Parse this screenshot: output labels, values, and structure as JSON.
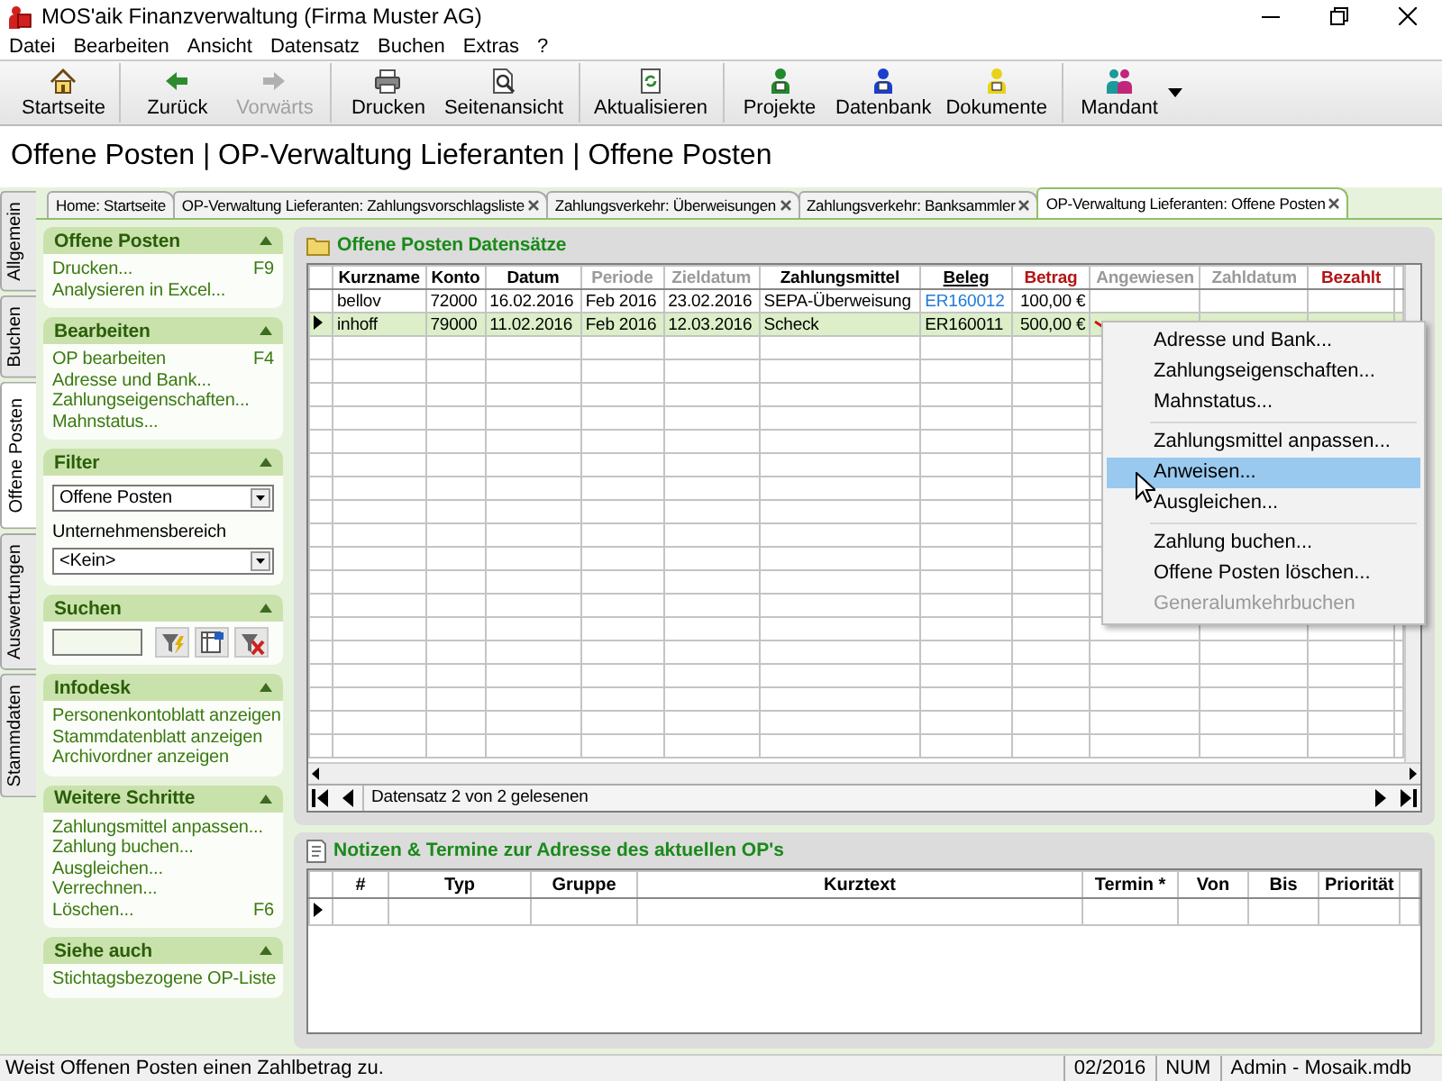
{
  "window": {
    "title": "MOS'aik Finanzverwaltung (Firma Muster AG)"
  },
  "menu": [
    "Datei",
    "Bearbeiten",
    "Ansicht",
    "Datensatz",
    "Buchen",
    "Extras",
    "?"
  ],
  "toolbar": [
    [
      {
        "label": "Startseite",
        "disabled": false
      }
    ],
    [
      {
        "label": "Zurück",
        "disabled": false
      },
      {
        "label": "Vorwärts",
        "disabled": true
      }
    ],
    [
      {
        "label": "Drucken",
        "disabled": false
      },
      {
        "label": "Seitenansicht",
        "disabled": false
      }
    ],
    [
      {
        "label": "Aktualisieren",
        "disabled": false
      }
    ],
    [
      {
        "label": "Projekte",
        "disabled": false
      },
      {
        "label": "Datenbank",
        "disabled": false
      },
      {
        "label": "Dokumente",
        "disabled": false
      }
    ],
    [
      {
        "label": "Mandant",
        "disabled": false,
        "dropdown": true
      }
    ]
  ],
  "heading": "Offene Posten | OP-Verwaltung Lieferanten | Offene Posten",
  "side_tabs": [
    {
      "label": "Allgemein",
      "selected": false
    },
    {
      "label": "Buchen",
      "selected": false
    },
    {
      "label": "Offene Posten",
      "selected": true
    },
    {
      "label": "Auswertungen",
      "selected": false
    },
    {
      "label": "Stammdaten",
      "selected": false
    }
  ],
  "doc_tabs": [
    {
      "label": "Home: Startseite",
      "closable": false,
      "selected": false
    },
    {
      "label": "OP-Verwaltung Lieferanten: Zahlungsvorschlagsliste",
      "closable": true,
      "selected": false
    },
    {
      "label": "Zahlungsverkehr: Überweisungen",
      "closable": true,
      "selected": false
    },
    {
      "label": "Zahlungsverkehr: Banksammler",
      "closable": true,
      "selected": false
    },
    {
      "label": "OP-Verwaltung Lieferanten: Offene Posten",
      "closable": true,
      "selected": true
    }
  ],
  "sidebar": [
    {
      "title": "Offene Posten",
      "kind": "links",
      "items": [
        {
          "label": "Drucken...",
          "shortcut": "F9"
        },
        {
          "label": "Analysieren in Excel..."
        }
      ]
    },
    {
      "title": "Bearbeiten",
      "kind": "links",
      "items": [
        {
          "label": "OP bearbeiten",
          "shortcut": "F4"
        },
        {
          "label": "Adresse und Bank..."
        },
        {
          "label": "Zahlungseigenschaften..."
        },
        {
          "label": "Mahnstatus..."
        }
      ]
    },
    {
      "title": "Filter",
      "kind": "filter",
      "fields": [
        {
          "kind": "select",
          "value": "Offene Posten"
        },
        {
          "kind": "label",
          "text": "Unternehmensbereich"
        },
        {
          "kind": "select",
          "value": "<Kein>"
        }
      ]
    },
    {
      "title": "Suchen",
      "kind": "search"
    },
    {
      "title": "Infodesk",
      "kind": "links",
      "items": [
        {
          "label": "Personenkontoblatt anzeigen"
        },
        {
          "label": "Stammdatenblatt anzeigen"
        },
        {
          "label": "Archivordner anzeigen"
        }
      ]
    },
    {
      "title": "Weitere Schritte",
      "kind": "links",
      "items": [
        {
          "label": "Zahlungsmittel anpassen..."
        },
        {
          "label": "Zahlung buchen..."
        },
        {
          "label": "Ausgleichen..."
        },
        {
          "label": "Verrechnen..."
        },
        {
          "label": "Löschen...",
          "shortcut": "F6"
        }
      ]
    },
    {
      "title": "Siehe auch",
      "kind": "links",
      "items": [
        {
          "label": "Stichtagsbezogene OP-Liste"
        }
      ]
    }
  ],
  "records": {
    "title": "Offene Posten Datensätze",
    "columns": [
      {
        "label": "Kurzname",
        "kind": "text"
      },
      {
        "label": "Konto",
        "kind": "text"
      },
      {
        "label": "Datum",
        "kind": "text"
      },
      {
        "label": "Periode",
        "kind": "muted"
      },
      {
        "label": "Zieldatum",
        "kind": "muted"
      },
      {
        "label": "Zahlungsmittel",
        "kind": "text"
      },
      {
        "label": "Beleg",
        "kind": "link"
      },
      {
        "label": "Betrag",
        "kind": "amount"
      },
      {
        "label": "Angewiesen",
        "kind": "muted"
      },
      {
        "label": "Zahldatum",
        "kind": "muted"
      },
      {
        "label": "Bezahlt",
        "kind": "red"
      }
    ],
    "rows": [
      {
        "selected": false,
        "marked": false,
        "cells": [
          "bellov",
          "72000",
          "16.02.2016",
          "Feb 2016",
          "23.02.2016",
          "SEPA-Überweisung",
          "ER160012",
          "100,00 €",
          "",
          "",
          ""
        ]
      },
      {
        "selected": true,
        "marked": true,
        "cells": [
          "inhoff",
          "79000",
          "11.02.2016",
          "Feb 2016",
          "12.03.2016",
          "Scheck",
          "ER160011",
          "500,00 €",
          "",
          "",
          ""
        ]
      }
    ],
    "navigator": "Datensatz 2 von 2 gelesenen"
  },
  "notes": {
    "title": "Notizen & Termine zur Adresse des aktuellen OP's",
    "columns": [
      "#",
      "Typ",
      "Gruppe",
      "Kurztext",
      "Termin *",
      "Von",
      "Bis",
      "Priorität"
    ],
    "rows": [
      {
        "selected": true
      }
    ]
  },
  "context_menu": {
    "groups": [
      [
        {
          "label": "Adresse und Bank...",
          "selected": false,
          "disabled": false
        },
        {
          "label": "Zahlungseigenschaften...",
          "selected": false,
          "disabled": false
        },
        {
          "label": "Mahnstatus...",
          "selected": false,
          "disabled": false
        }
      ],
      [
        {
          "label": "Zahlungsmittel anpassen...",
          "selected": false,
          "disabled": false
        },
        {
          "label": "Anweisen...",
          "selected": true,
          "disabled": false
        },
        {
          "label": "Ausgleichen...",
          "selected": false,
          "disabled": false
        }
      ],
      [
        {
          "label": "Zahlung buchen...",
          "selected": false,
          "disabled": false
        },
        {
          "label": "Offene Posten löschen...",
          "selected": false,
          "disabled": false
        },
        {
          "label": "Generalumkehrbuchen",
          "selected": false,
          "disabled": true
        }
      ]
    ]
  },
  "status_bar": {
    "message": "Weist Offenen Posten einen Zahlbetrag zu.",
    "period": "02/2016",
    "mode": "NUM",
    "database": "Admin - Mosaik.mdb"
  }
}
